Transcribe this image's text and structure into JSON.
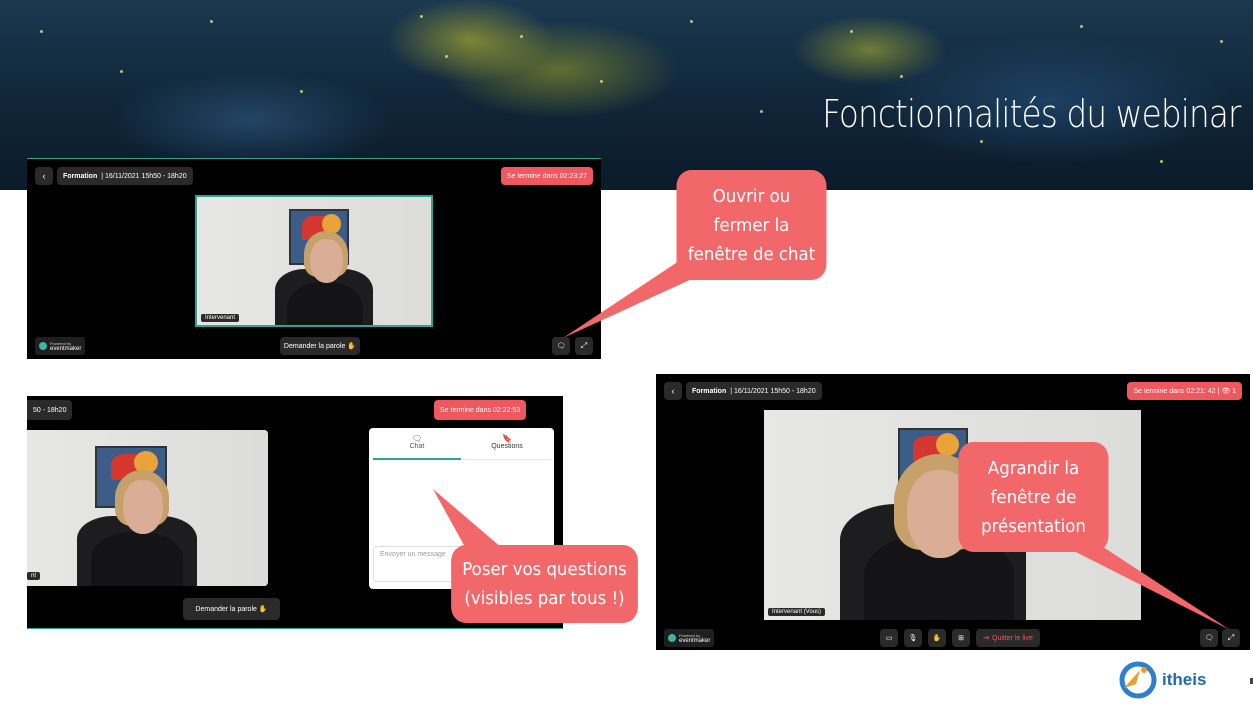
{
  "slide": {
    "title": "Fonctionnalités du webinar"
  },
  "shot1": {
    "pill_title": "Formation",
    "pill_date": "| 16/11/2021 15h50 - 18h20",
    "timer": "Se termine dans 02:23:27",
    "speaker_tag": "Intervenant",
    "request_button": "Demander la parole ✋",
    "powered_line1": "Powered by",
    "powered_line2": "eventmaker"
  },
  "shot2": {
    "pill_date": "50 - 18h20",
    "timer": "Se termine dans 02:22:53",
    "tab_chat": "Chat",
    "tab_questions": "Questions",
    "message_placeholder": "Envoyer un message",
    "speaker_tag": "nt",
    "request_button": "Demander la parole ✋"
  },
  "shot3": {
    "pill_title": "Formation",
    "pill_date": "| 16/11/2021 15h50 - 18h20",
    "timer": "Se termine dans 02:21: 42  |  👁 1",
    "speaker_tag": "Intervenant (Vous)",
    "leave_button": "Quitter le live",
    "powered_line1": "Powered by",
    "powered_line2": "eventmaker"
  },
  "callouts": {
    "chat_toggle": [
      "Ouvrir ou",
      "fermer la",
      "fenêtre de chat"
    ],
    "questions": [
      "Poser vos questions",
      "(visibles par tous !)"
    ],
    "expand": [
      "Agrandir la",
      "fenêtre de",
      "présentation"
    ]
  },
  "brand": {
    "name": "itheis"
  },
  "colors": {
    "callout": "#f26769",
    "timer": "#f0585f",
    "accent": "#2aa596"
  }
}
